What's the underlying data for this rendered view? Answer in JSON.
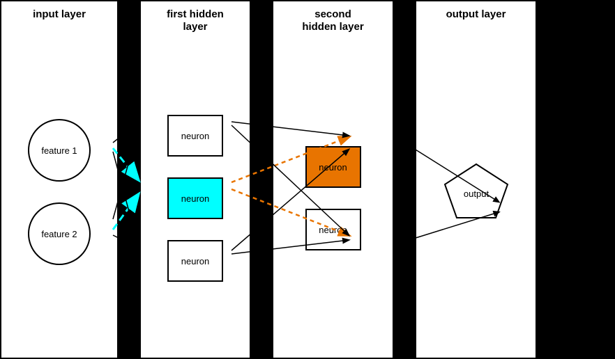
{
  "layers": {
    "input": {
      "title": "input layer",
      "nodes": [
        {
          "label": "feature 1"
        },
        {
          "label": "feature 2"
        }
      ]
    },
    "hidden1": {
      "title": "first hidden\nlayer",
      "nodes": [
        {
          "label": "neuron",
          "style": "normal"
        },
        {
          "label": "neuron",
          "style": "cyan"
        },
        {
          "label": "neuron",
          "style": "normal"
        }
      ]
    },
    "hidden2": {
      "title": "second\nhidden layer",
      "nodes": [
        {
          "label": "neuron",
          "style": "orange"
        },
        {
          "label": "neuron",
          "style": "normal"
        }
      ]
    },
    "output": {
      "title": "output layer",
      "nodes": [
        {
          "label": "output",
          "style": "pentagon"
        }
      ]
    }
  }
}
